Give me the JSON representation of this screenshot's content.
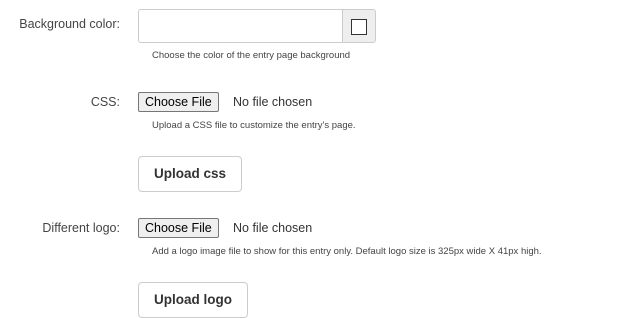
{
  "background_color": {
    "label": "Background color:",
    "value": "",
    "swatch_color": "#ffffff",
    "help": "Choose the color of the entry page background"
  },
  "css": {
    "label": "CSS:",
    "choose_file_label": "Choose File",
    "file_status": "No file chosen",
    "help": "Upload a CSS file to customize the entry's page.",
    "upload_button": "Upload css"
  },
  "logo": {
    "label": "Different logo:",
    "choose_file_label": "Choose File",
    "file_status": "No file chosen",
    "help": "Add a logo image file to show for this entry only. Default logo size is 325px wide X 41px high.",
    "upload_button": "Upload logo"
  }
}
